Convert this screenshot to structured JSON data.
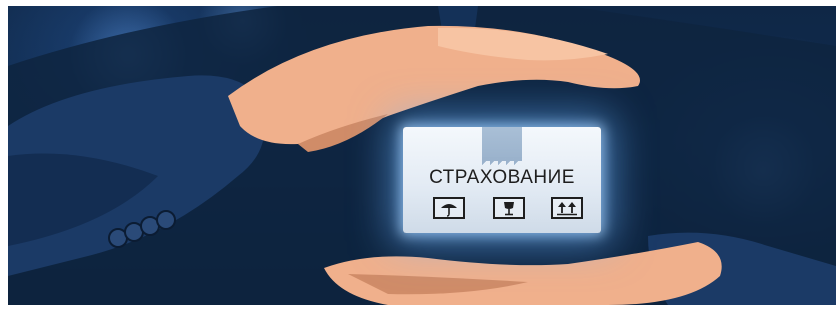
{
  "image": {
    "box": {
      "label": "СТРАХОВАНИЕ",
      "icons": [
        "umbrella-icon",
        "fragile-glass-icon",
        "this-side-up-icon"
      ]
    },
    "colors": {
      "background": "#102c50",
      "glow": "#6eb4ff",
      "box": "#e3ebf4",
      "tape": "#9ab2cc",
      "skin": "#f0b08c",
      "text": "#1e1e1e"
    }
  }
}
